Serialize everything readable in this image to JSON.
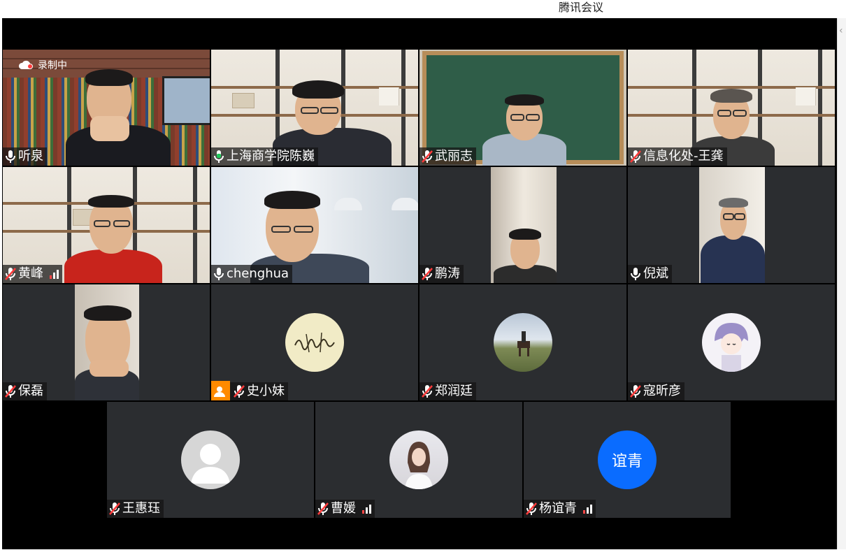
{
  "window": {
    "title": "腾讯会议"
  },
  "recording": {
    "label": "录制中"
  },
  "participants": [
    {
      "name": "听泉",
      "mic": "on"
    },
    {
      "name": "上海商学院陈巍",
      "mic": "speaking"
    },
    {
      "name": "武丽志",
      "mic": "muted"
    },
    {
      "name": "信息化处-王龚",
      "mic": "muted"
    },
    {
      "name": "黄峰",
      "mic": "muted",
      "signal": "weak"
    },
    {
      "name": "chenghua",
      "mic": "on"
    },
    {
      "name": "鹏涛",
      "mic": "muted"
    },
    {
      "name": "倪斌",
      "mic": "on"
    },
    {
      "name": "保磊",
      "mic": "muted"
    },
    {
      "name": "史小妹",
      "mic": "muted",
      "host": true
    },
    {
      "name": "郑润廷",
      "mic": "muted"
    },
    {
      "name": "寇昕彦",
      "mic": "muted"
    },
    {
      "name": "王惠珏",
      "mic": "muted"
    },
    {
      "name": "曹媛",
      "mic": "muted",
      "signal": "ok"
    },
    {
      "name": "杨谊青",
      "mic": "muted",
      "signal": "ok",
      "avatar_text": "谊青"
    }
  ],
  "colors": {
    "active_speaker": "#1fc75a",
    "avatar_blue": "#0a6cff",
    "host_badge": "#ff8a00"
  }
}
